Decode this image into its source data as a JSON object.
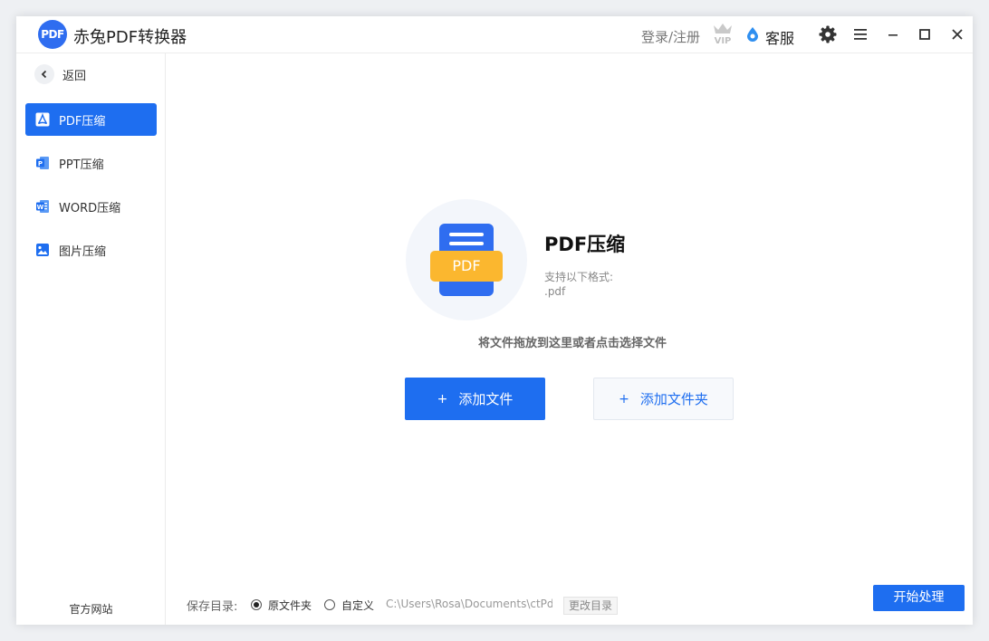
{
  "titlebar": {
    "logo_text": "PDF",
    "app_title": "赤兔PDF转换器",
    "login_label": "登录/注册",
    "vip_label": "VIP",
    "service_label": "客服",
    "icons": [
      "settings-gear-icon",
      "menu-icon",
      "minimize-icon",
      "maximize-icon",
      "close-icon"
    ]
  },
  "sidebar": {
    "back_label": "返回",
    "items": [
      {
        "label": "PDF压缩",
        "icon": "pdf-icon",
        "active": true
      },
      {
        "label": "PPT压缩",
        "icon": "ppt-icon",
        "active": false
      },
      {
        "label": "WORD压缩",
        "icon": "word-icon",
        "active": false
      },
      {
        "label": "图片压缩",
        "icon": "image-icon",
        "active": false
      }
    ],
    "official_site": "官方网站"
  },
  "main": {
    "doc_badge": "PDF",
    "title": "PDF压缩",
    "support_label": "支持以下格式:",
    "support_ext": ".pdf",
    "drop_hint": "将文件拖放到这里或者点击选择文件",
    "add_file_label": "添加文件",
    "add_folder_label": "添加文件夹",
    "plus_glyph": "+"
  },
  "footer": {
    "save_label": "保存目录:",
    "radio_original": "原文件夹",
    "radio_custom": "自定义",
    "selected": "original",
    "path": "C:\\Users\\Rosa\\Documents\\ctPd",
    "change_dir_label": "更改目录",
    "start_label": "开始处理"
  },
  "colors": {
    "accent": "#1e6ef0",
    "pdf_yellow": "#fbb72f"
  }
}
